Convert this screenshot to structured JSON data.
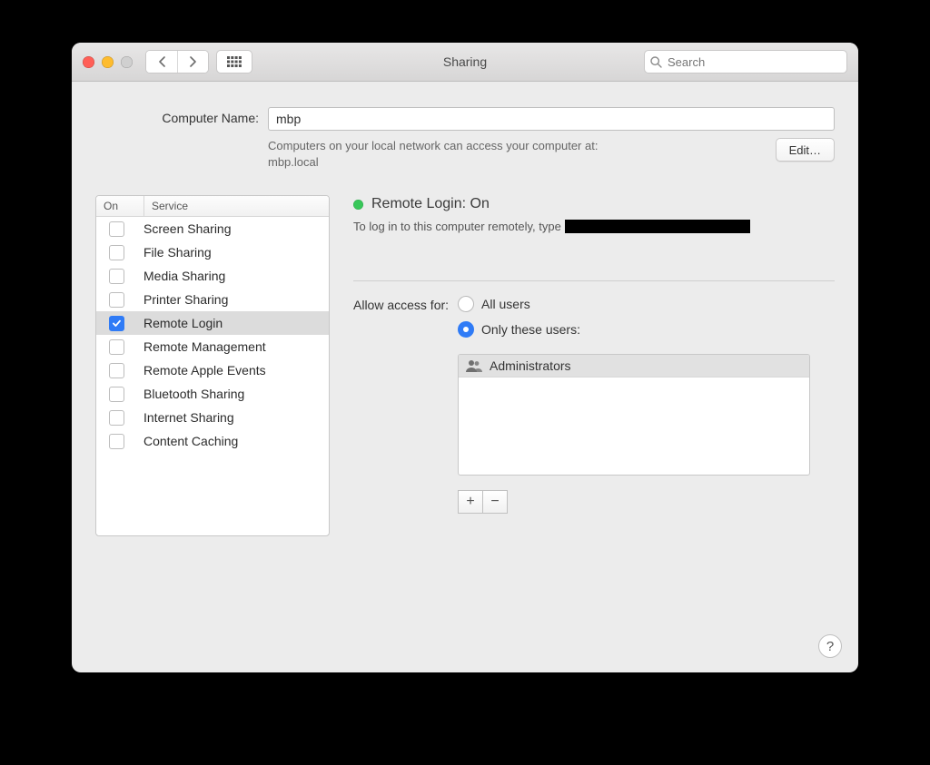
{
  "window": {
    "title": "Sharing"
  },
  "toolbar": {
    "search_placeholder": "Search"
  },
  "computer_name": {
    "label": "Computer Name:",
    "value": "mbp",
    "hint_line1": "Computers on your local network can access your computer at:",
    "hint_line2": "mbp.local",
    "edit_label": "Edit…"
  },
  "services": {
    "col_on": "On",
    "col_service": "Service",
    "items": [
      {
        "label": "Screen Sharing",
        "on": false,
        "selected": false
      },
      {
        "label": "File Sharing",
        "on": false,
        "selected": false
      },
      {
        "label": "Media Sharing",
        "on": false,
        "selected": false
      },
      {
        "label": "Printer Sharing",
        "on": false,
        "selected": false
      },
      {
        "label": "Remote Login",
        "on": true,
        "selected": true
      },
      {
        "label": "Remote Management",
        "on": false,
        "selected": false
      },
      {
        "label": "Remote Apple Events",
        "on": false,
        "selected": false
      },
      {
        "label": "Bluetooth Sharing",
        "on": false,
        "selected": false
      },
      {
        "label": "Internet Sharing",
        "on": false,
        "selected": false
      },
      {
        "label": "Content Caching",
        "on": false,
        "selected": false
      }
    ]
  },
  "detail": {
    "status_label": "Remote Login: On",
    "login_hint_prefix": "To log in to this computer remotely, type",
    "access_label": "Allow access for:",
    "radio_all": "All users",
    "radio_only": "Only these users:",
    "users": [
      {
        "label": "Administrators"
      }
    ]
  },
  "colors": {
    "accent": "#2f7bf6",
    "status_on": "#38c759"
  }
}
